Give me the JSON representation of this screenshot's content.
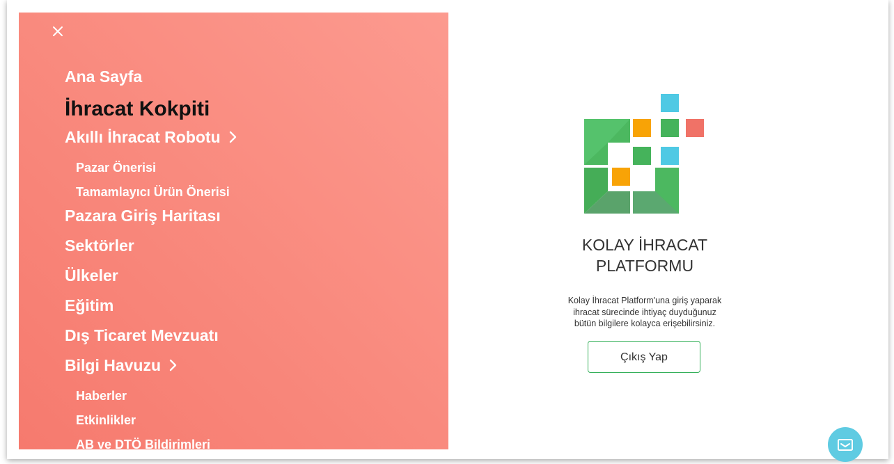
{
  "menu": {
    "close_icon": "close-icon",
    "items": [
      {
        "label": "Ana Sayfa"
      },
      {
        "label": "İhracat Kokpiti",
        "active": true
      },
      {
        "label": "Akıllı İhracat Robotu",
        "has_submenu": true
      },
      {
        "label": "Pazar Önerisi",
        "sub": true
      },
      {
        "label": "Tamamlayıcı Ürün Önerisi",
        "sub": true
      },
      {
        "label": "Pazara Giriş Haritası"
      },
      {
        "label": "Sektörler"
      },
      {
        "label": "Ülkeler"
      },
      {
        "label": "Eğitim"
      },
      {
        "label": "Dış Ticaret Mevzuatı"
      },
      {
        "label": "Bilgi Havuzu",
        "has_submenu": true
      },
      {
        "label": "Haberler",
        "sub": true
      },
      {
        "label": "Etkinlikler",
        "sub": true
      },
      {
        "label": "AB ve DTÖ Bildirimleri",
        "sub": true
      }
    ]
  },
  "brand": {
    "title_line1": "KOLAY İHRACAT",
    "title_line2": "PLATFORMU",
    "description": [
      "Kolay İhracat Platform'una giriş yaparak",
      "ihracat sürecinde ihtiyaç duyduğunuz",
      "bütün bilgilere kolayca erişebilirsiniz."
    ]
  },
  "actions": {
    "logout_label": "Çıkış Yap"
  },
  "colors": {
    "menu_gradient_start": "#fc9a8f",
    "menu_gradient_end": "#f67a6e",
    "active_text": "#111111",
    "accent_green": "#35b05a",
    "logo_orange": "#f8a306",
    "logo_blue": "#4fc9e4",
    "logo_red": "#f07267",
    "chat_blue": "#5fcbe2"
  },
  "icons": {
    "chat": "chat-icon",
    "chevron": "chevron-right-icon"
  }
}
